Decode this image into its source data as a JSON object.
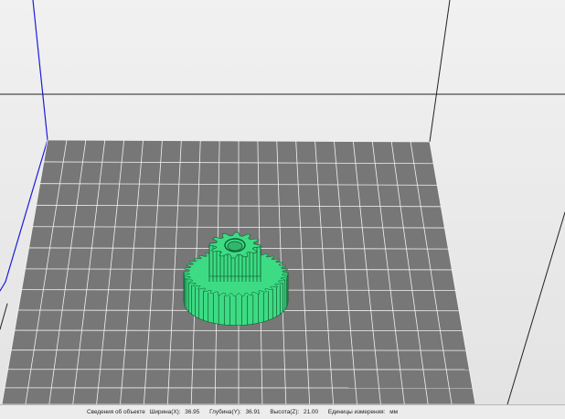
{
  "status_bar": {
    "info_label": "Сведения об объекте",
    "width_label": "Ширина(X):",
    "width_value": "36.95",
    "depth_label": "Глубина(Y):",
    "depth_value": "36.91",
    "height_label": "Высота(Z):",
    "height_value": "21.00",
    "units_label": "Единицы измерения:",
    "units_value": "мм"
  },
  "colors": {
    "background": "#ececec",
    "bed": "#777777",
    "grid_line": "#f2f2f2",
    "model": "#3ddc84",
    "model_edge": "#0e5a30",
    "axis_blue": "#1a1ae0"
  },
  "icons": {
    "model": "gear-model"
  }
}
